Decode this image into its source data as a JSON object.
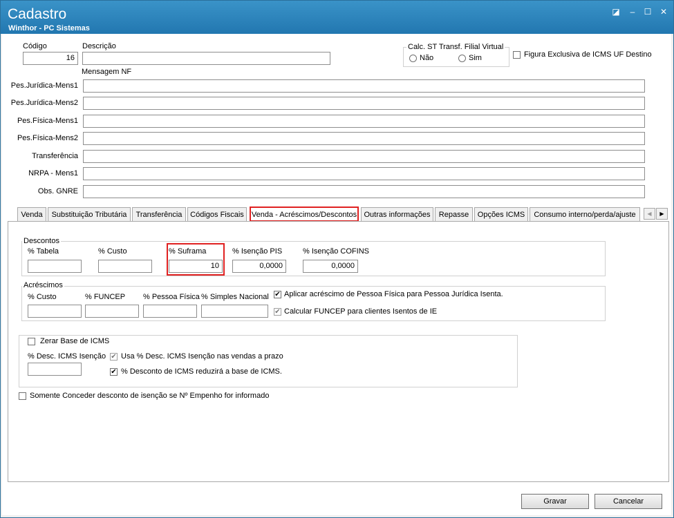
{
  "window": {
    "title": "Cadastro",
    "subtitle": "Winthor - PC Sistemas",
    "controls": {
      "restore": "◪",
      "minimize": "–",
      "maximize": "☐",
      "close": "✕"
    }
  },
  "header": {
    "codigo_label": "Código",
    "codigo_value": "16",
    "descricao_label": "Descrição",
    "descricao_value": "",
    "calc_st_title": "Calc. ST Transf. Filial Virtual",
    "radio_nao": "Não",
    "radio_sim": "Sim",
    "figura_label": "Figura Exclusiva de ICMS UF Destino",
    "mensagem_nf_label": "Mensagem NF"
  },
  "messages": [
    {
      "label": "Pes.Jurídica-Mens1",
      "value": ""
    },
    {
      "label": "Pes.Jurídica-Mens2",
      "value": ""
    },
    {
      "label": "Pes.Física-Mens1",
      "value": ""
    },
    {
      "label": "Pes.Física-Mens2",
      "value": ""
    },
    {
      "label": "Transferência",
      "value": ""
    },
    {
      "label": "NRPA - Mens1",
      "value": ""
    },
    {
      "label": "Obs. GNRE",
      "value": ""
    }
  ],
  "tabs": [
    {
      "label": "Venda"
    },
    {
      "label": "Substituição Tributária"
    },
    {
      "label": "Transferência"
    },
    {
      "label": "Códigos Fiscais"
    },
    {
      "label": "Venda - Acréscimos/Descontos"
    },
    {
      "label": "Outras informações"
    },
    {
      "label": "Repasse"
    },
    {
      "label": "Opções ICMS"
    },
    {
      "label": "Consumo interno/perda/ajuste"
    }
  ],
  "tab_scroll": {
    "left": "◀",
    "right": "▶"
  },
  "descontos": {
    "title": "Descontos",
    "fields": [
      {
        "label": "% Tabela",
        "value": ""
      },
      {
        "label": "% Custo",
        "value": ""
      },
      {
        "label": "% Suframa",
        "value": "10"
      },
      {
        "label": "% Isenção PIS",
        "value": "0,0000"
      },
      {
        "label": "% Isenção COFINS",
        "value": "0,0000"
      }
    ]
  },
  "acrescimos": {
    "title": "Acréscimos",
    "fields": [
      {
        "label": "% Custo",
        "value": ""
      },
      {
        "label": "% FUNCEP",
        "value": ""
      },
      {
        "label": "% Pessoa Física",
        "value": ""
      },
      {
        "label": "% Simples Nacional",
        "value": ""
      }
    ],
    "check_aplicar": "Aplicar acréscimo de Pessoa Física para Pessoa Jurídica Isenta.",
    "check_funcep": "Calcular FUNCEP para clientes Isentos de IE"
  },
  "icms": {
    "zerar_label": "Zerar Base de ICMS",
    "desc_isencao_label": "% Desc. ICMS Isenção",
    "desc_isencao_value": "",
    "usa_label": "Usa % Desc. ICMS Isenção nas vendas a prazo",
    "reduz_label": "% Desconto de ICMS reduzirá a base de ICMS."
  },
  "somente_label": "Somente Conceder desconto de isenção se Nº Empenho for informado",
  "buttons": {
    "gravar": "Gravar",
    "cancelar": "Cancelar"
  },
  "checkmark": "✔"
}
